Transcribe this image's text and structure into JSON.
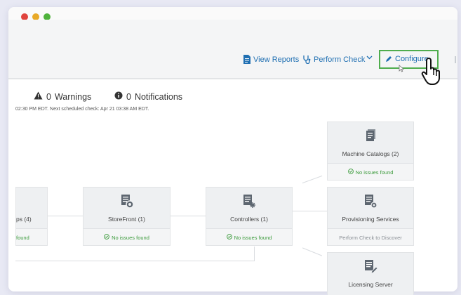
{
  "toolbar": {
    "view_reports": "View Reports",
    "perform_check": "Perform Check",
    "configure": "Configure"
  },
  "summary": {
    "warnings_count": "0",
    "warnings_label": "Warnings",
    "notifications_count": "0",
    "notifications_label": "Notifications",
    "check_info": "02:30 PM EDT. Next scheduled check: Apr 21 03:38 AM EDT."
  },
  "cards": {
    "groups": {
      "title": "ps (4)",
      "status": "found"
    },
    "storefront": {
      "title": "StoreFront (1)",
      "status": "No issues found"
    },
    "controllers": {
      "title": "Controllers (1)",
      "status": "No issues found"
    },
    "machine_catalogs": {
      "title": "Machine Catalogs (2)",
      "status": "No issues found"
    },
    "provisioning": {
      "title": "Provisioning Services",
      "status": "Perform Check to Discover"
    },
    "licensing": {
      "title": "Licensing Server"
    }
  },
  "colors": {
    "link": "#1f6fb2",
    "ok_green": "#3a9a3a",
    "highlight_green": "#4fad4e"
  }
}
